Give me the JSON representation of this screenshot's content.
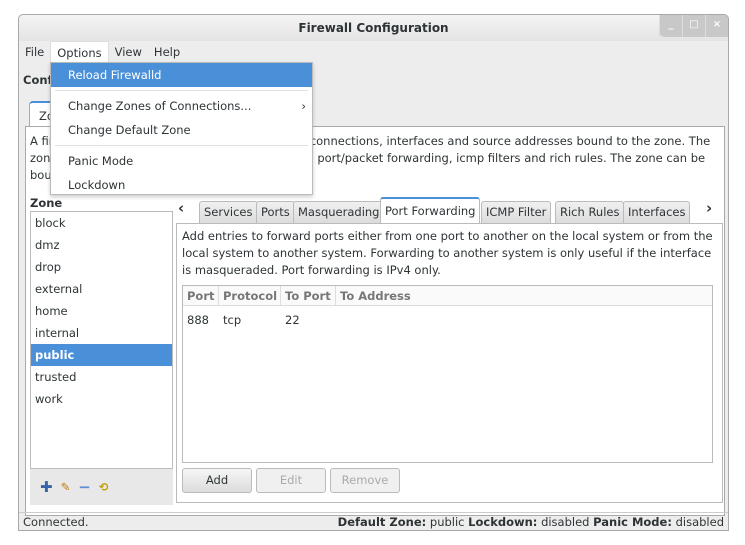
{
  "window": {
    "title": "Firewall Configuration",
    "controls": [
      "_",
      "□",
      "×"
    ]
  },
  "menubar": [
    "File",
    "Options",
    "View",
    "Help"
  ],
  "options_menu": {
    "items": [
      "Reload Firewalld",
      "Change Zones of Connections...",
      "Change Default Zone",
      "Panic Mode",
      "Lockdown"
    ],
    "submenu_arrow": "›"
  },
  "config_label": "Conf",
  "outer_tab": "Zo",
  "description": "A fir                                        k connections, interfaces and source addresses bound to the zone. The zon                                        ng, port/packet forwarding, icmp filters and rich rules. The zone can be bour",
  "desc_lines": [
    "A fir",
    "zone",
    "bour"
  ],
  "desc_right": [
    "k connections, interfaces and source addresses bound to the zone. The",
    "ng, port/packet forwarding, icmp filters and rich rules. The zone can be"
  ],
  "zone_label": "Zone",
  "zones": [
    "block",
    "dmz",
    "drop",
    "external",
    "home",
    "internal",
    "public",
    "trusted",
    "work"
  ],
  "selected_zone": "public",
  "tabs": [
    "Services",
    "Ports",
    "Masquerading",
    "Port Forwarding",
    "ICMP Filter",
    "Rich Rules",
    "Interfaces"
  ],
  "active_tab": "Port Forwarding",
  "port_forwarding": {
    "description": "Add entries to forward ports either from one port to another on the local system or from the local system to another system. Forwarding to another system is only useful if the interface is masqueraded. Port forwarding is IPv4 only.",
    "columns": [
      "Port",
      "Protocol",
      "To Port",
      "To Address"
    ],
    "rows": [
      [
        "888",
        "tcp",
        "22",
        ""
      ]
    ],
    "buttons": {
      "add": "Add",
      "edit": "Edit",
      "remove": "Remove"
    }
  },
  "status": {
    "left": "Connected.",
    "default_zone_label": "Default Zone:",
    "default_zone": "public",
    "lockdown_label": "Lockdown:",
    "lockdown": "disabled",
    "panic_label": "Panic Mode:",
    "panic": "disabled"
  },
  "colors": {
    "accent": "#4a90d9"
  }
}
